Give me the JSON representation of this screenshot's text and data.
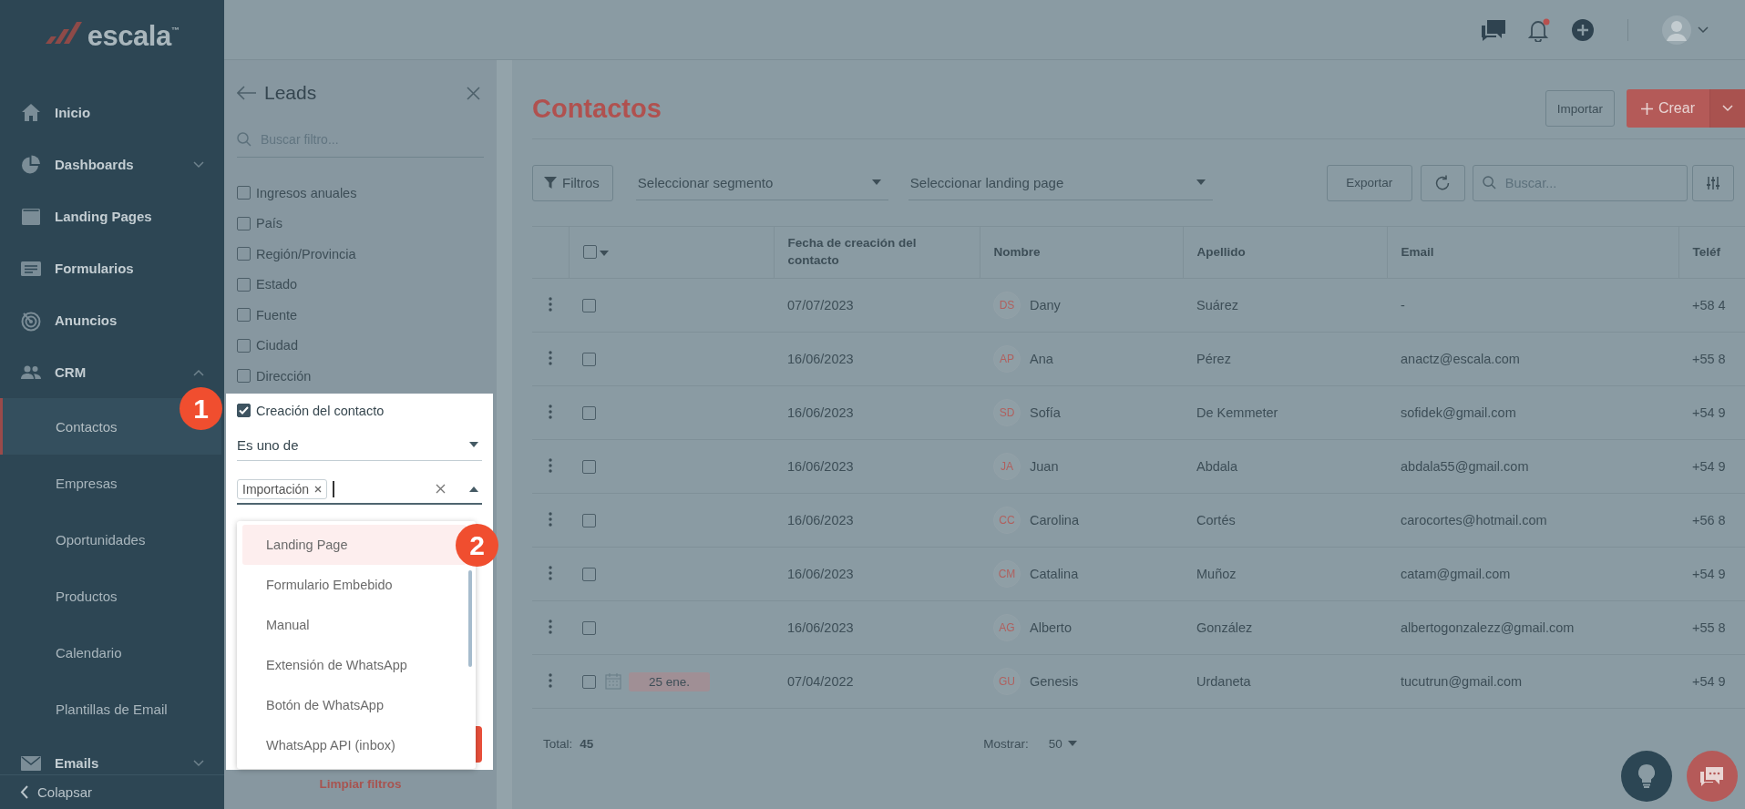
{
  "logo": {
    "text": "escala",
    "mark": "™"
  },
  "sidebar": {
    "items": [
      {
        "label": "Inicio",
        "selected": false
      },
      {
        "label": "Dashboards",
        "selected": false,
        "expanded": false
      },
      {
        "label": "Landing Pages",
        "selected": false
      },
      {
        "label": "Formularios",
        "selected": false
      },
      {
        "label": "Anuncios",
        "selected": false
      },
      {
        "label": "CRM",
        "selected": false,
        "expanded": true,
        "children": [
          {
            "label": "Contactos",
            "selected": true
          },
          {
            "label": "Empresas",
            "selected": false
          },
          {
            "label": "Oportunidades",
            "selected": false
          },
          {
            "label": "Productos",
            "selected": false
          },
          {
            "label": "Calendario",
            "selected": false
          },
          {
            "label": "Plantillas de Email",
            "selected": false
          }
        ]
      },
      {
        "label": "Emails",
        "selected": false,
        "expanded": false
      }
    ],
    "collapse": "Colapsar"
  },
  "header": {
    "notification": true
  },
  "filter_panel": {
    "title": "Leads",
    "search": {
      "placeholder": "Buscar filtro..."
    },
    "filters": [
      {
        "label": "Ingresos anuales",
        "checked": false
      },
      {
        "label": "País",
        "checked": false
      },
      {
        "label": "Región/Provincia",
        "checked": false
      },
      {
        "label": "Estado",
        "checked": false
      },
      {
        "label": "Fuente",
        "checked": false
      },
      {
        "label": "Ciudad",
        "checked": false
      },
      {
        "label": "Dirección",
        "checked": false
      },
      {
        "label": "Creación del contacto",
        "checked": true
      }
    ],
    "condition": {
      "value": "Es uno de"
    },
    "chips": [
      "Importación"
    ],
    "options": [
      {
        "label": "Landing Page",
        "selected": true
      },
      {
        "label": "Formulario Embebido",
        "selected": false
      },
      {
        "label": "Manual",
        "selected": false
      },
      {
        "label": "Extensión de WhatsApp",
        "selected": false
      },
      {
        "label": "Botón de WhatsApp",
        "selected": false
      },
      {
        "label": "WhatsApp API (inbox)",
        "selected": false
      }
    ],
    "clear_link": "Limpiar filtros"
  },
  "page": {
    "title": "Contactos",
    "import_button": "Importar",
    "create_button": "Crear",
    "toolbar": {
      "filters_button": "Filtros",
      "segment_select": {
        "placeholder": "Seleccionar segmento"
      },
      "landing_select": {
        "placeholder": "Seleccionar landing page"
      },
      "export_button": "Exportar",
      "search": {
        "placeholder": "Buscar..."
      }
    },
    "table": {
      "select_all": {
        "checked": false
      },
      "columns": [
        "Fecha de creación del contacto",
        "Nombre",
        "Apellido",
        "Email",
        "Teléf"
      ],
      "rows": [
        {
          "checked": false,
          "date": "07/07/2023",
          "initials": "DS",
          "name": "Dany",
          "surname": "Suárez",
          "email": "-",
          "phone": "+58 4"
        },
        {
          "checked": false,
          "date": "16/06/2023",
          "initials": "AP",
          "name": "Ana",
          "surname": "Pérez",
          "email": "anactz@escala.com",
          "phone": "+55 8"
        },
        {
          "checked": false,
          "date": "16/06/2023",
          "initials": "SD",
          "name": "Sofía",
          "surname": "De Kemmeter",
          "email": "sofidek@gmail.com",
          "phone": "+54 9"
        },
        {
          "checked": false,
          "date": "16/06/2023",
          "initials": "JA",
          "name": "Juan",
          "surname": "Abdala",
          "email": "abdala55@gmail.com",
          "phone": "+54 9"
        },
        {
          "checked": false,
          "date": "16/06/2023",
          "initials": "CC",
          "name": "Carolina",
          "surname": "Cortés",
          "email": "carocortes@hotmail.com",
          "phone": "+56 8"
        },
        {
          "checked": false,
          "date": "16/06/2023",
          "initials": "CM",
          "name": "Catalina",
          "surname": "Muñoz",
          "email": "catam@gmail.com",
          "phone": "+54 9"
        },
        {
          "checked": false,
          "date": "16/06/2023",
          "initials": "AG",
          "name": "Alberto",
          "surname": "González",
          "email": "albertogonzalezz@gmail.com",
          "phone": "+55 8"
        },
        {
          "checked": false,
          "task": "25 ene.",
          "date": "07/04/2022",
          "initials": "GU",
          "name": "Genesis",
          "surname": "Urdaneta",
          "email": "tucutrun@gmail.com",
          "phone": "+54 9"
        }
      ]
    },
    "footer": {
      "total_label": "Total:",
      "total": "45",
      "show_label": "Mostrar:",
      "page_size": "50"
    }
  },
  "steps": [
    "1",
    "2"
  ]
}
